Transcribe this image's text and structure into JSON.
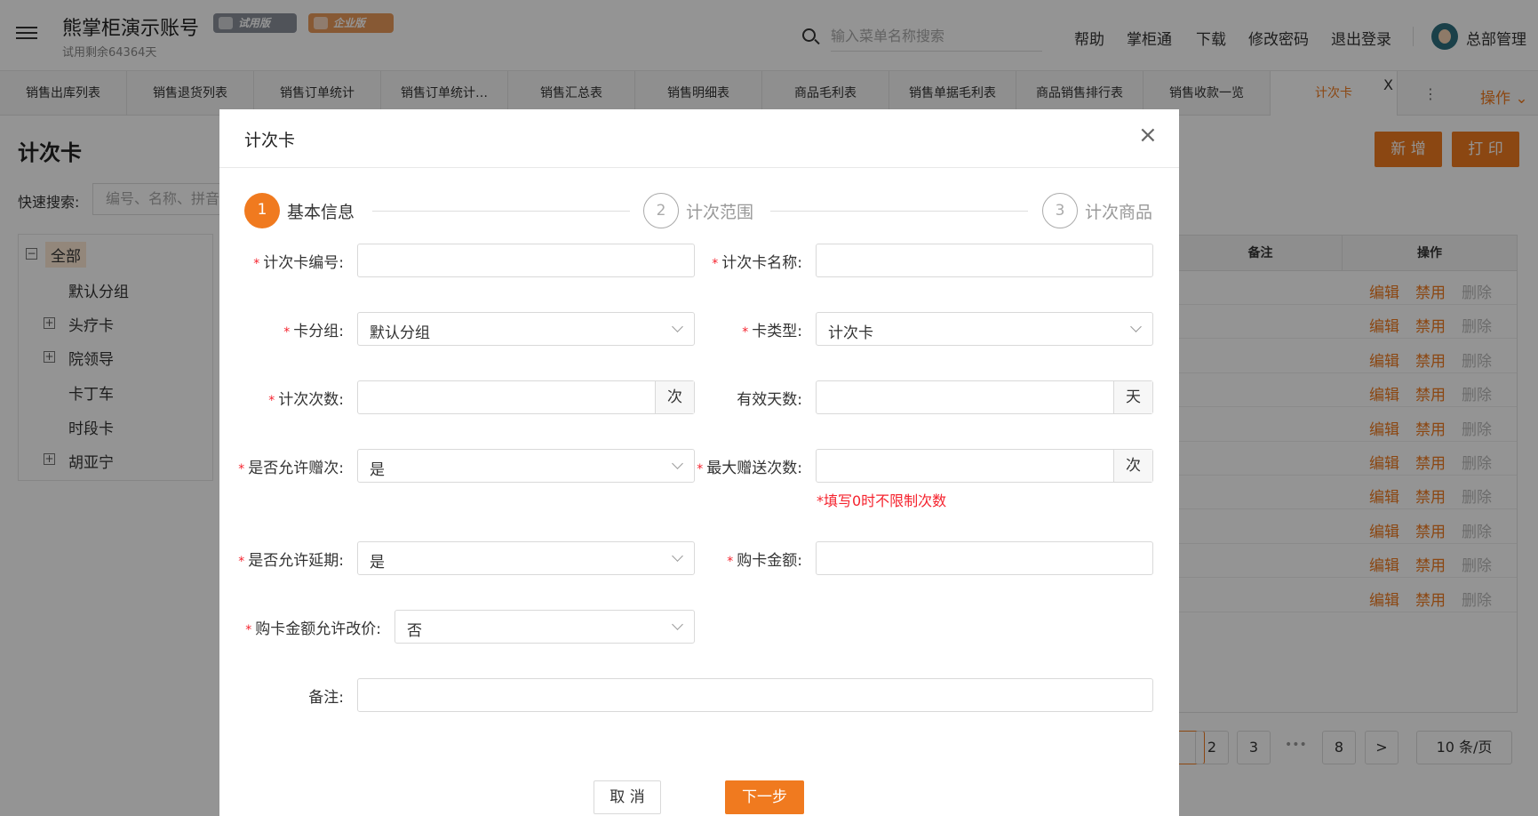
{
  "header": {
    "title": "熊掌柜演示账号",
    "subtitle": "试用剩余64364天",
    "badge_trial": "试用版",
    "badge_enterprise": "企业版",
    "search_placeholder": "输入菜单名称搜索",
    "links": [
      "帮助",
      "掌柜通",
      "下载",
      "修改密码",
      "退出登录"
    ],
    "user": "总部管理"
  },
  "tabs": [
    "销售出库列表",
    "销售退货列表",
    "销售订单统计",
    "销售订单统计…",
    "销售汇总表",
    "销售明细表",
    "商品毛利表",
    "销售单据毛利表",
    "商品销售排行表",
    "销售收款一览",
    "计次卡"
  ],
  "tab_close": "X",
  "ops_menu": "操作",
  "kebab": "⋮",
  "page": {
    "title": "计次卡",
    "btn_new": "新 增",
    "btn_print": "打 印",
    "quick_search_label": "快速搜索:",
    "quick_search_placeholder": "编号、名称、拼音",
    "tree": [
      {
        "label": "全部",
        "expander": "⊟"
      },
      {
        "label": "默认分组"
      },
      {
        "label": "头疗卡",
        "expander": "⊞"
      },
      {
        "label": "院领导",
        "expander": "⊞"
      },
      {
        "label": "卡丁车"
      },
      {
        "label": "时段卡"
      },
      {
        "label": "胡亚宁",
        "expander": "⊞"
      }
    ],
    "table": {
      "col_remark": "备注",
      "col_ops": "操作",
      "action_edit": "编辑",
      "action_disable": "禁用",
      "action_delete": "删除"
    },
    "pager": [
      "2",
      "3",
      "•••",
      "8",
      ">"
    ],
    "page_size": "10 条/页"
  },
  "modal": {
    "title": "计次卡",
    "close": "×",
    "steps": [
      {
        "num": "1",
        "label": "基本信息"
      },
      {
        "num": "2",
        "label": "计次范围"
      },
      {
        "num": "3",
        "label": "计次商品"
      }
    ],
    "required_mark": "*",
    "fields": {
      "card_no": {
        "label": "计次卡编号:",
        "value": ""
      },
      "card_name": {
        "label": "计次卡名称:",
        "value": ""
      },
      "card_group": {
        "label": "卡分组:",
        "value": "默认分组"
      },
      "card_type": {
        "label": "卡类型:",
        "value": "计次卡"
      },
      "count": {
        "label": "计次次数:",
        "value": "",
        "unit": "次"
      },
      "valid_days": {
        "label": "有效天数:",
        "value": "",
        "unit": "天"
      },
      "allow_gift": {
        "label": "是否允许赠次:",
        "value": "是"
      },
      "max_gift": {
        "label": "最大赠送次数:",
        "value": "",
        "unit": "次",
        "hint": "*填写0时不限制次数"
      },
      "allow_extend": {
        "label": "是否允许延期:",
        "value": "是"
      },
      "price": {
        "label": "购卡金额:",
        "value": ""
      },
      "allow_price_change": {
        "label": "购卡金额允许改价:",
        "value": "否"
      },
      "remark": {
        "label": "备注:",
        "value": ""
      }
    },
    "btn_cancel": "取 消",
    "btn_next": "下一步"
  }
}
